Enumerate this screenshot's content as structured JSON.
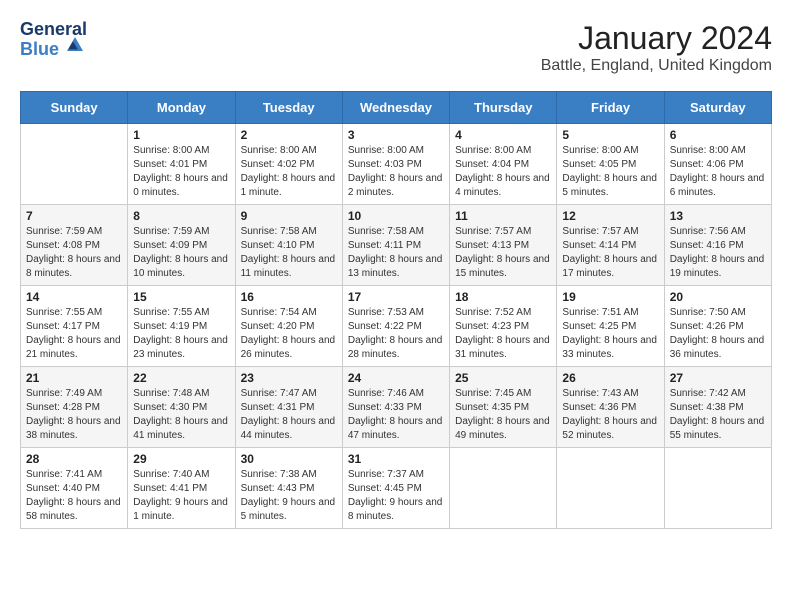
{
  "logo": {
    "general": "General",
    "blue": "Blue"
  },
  "title": "January 2024",
  "subtitle": "Battle, England, United Kingdom",
  "days_of_week": [
    "Sunday",
    "Monday",
    "Tuesday",
    "Wednesday",
    "Thursday",
    "Friday",
    "Saturday"
  ],
  "weeks": [
    [
      {
        "day": "",
        "sunrise": "",
        "sunset": "",
        "daylight": ""
      },
      {
        "day": "1",
        "sunrise": "Sunrise: 8:00 AM",
        "sunset": "Sunset: 4:01 PM",
        "daylight": "Daylight: 8 hours and 0 minutes."
      },
      {
        "day": "2",
        "sunrise": "Sunrise: 8:00 AM",
        "sunset": "Sunset: 4:02 PM",
        "daylight": "Daylight: 8 hours and 1 minute."
      },
      {
        "day": "3",
        "sunrise": "Sunrise: 8:00 AM",
        "sunset": "Sunset: 4:03 PM",
        "daylight": "Daylight: 8 hours and 2 minutes."
      },
      {
        "day": "4",
        "sunrise": "Sunrise: 8:00 AM",
        "sunset": "Sunset: 4:04 PM",
        "daylight": "Daylight: 8 hours and 4 minutes."
      },
      {
        "day": "5",
        "sunrise": "Sunrise: 8:00 AM",
        "sunset": "Sunset: 4:05 PM",
        "daylight": "Daylight: 8 hours and 5 minutes."
      },
      {
        "day": "6",
        "sunrise": "Sunrise: 8:00 AM",
        "sunset": "Sunset: 4:06 PM",
        "daylight": "Daylight: 8 hours and 6 minutes."
      }
    ],
    [
      {
        "day": "7",
        "sunrise": "Sunrise: 7:59 AM",
        "sunset": "Sunset: 4:08 PM",
        "daylight": "Daylight: 8 hours and 8 minutes."
      },
      {
        "day": "8",
        "sunrise": "Sunrise: 7:59 AM",
        "sunset": "Sunset: 4:09 PM",
        "daylight": "Daylight: 8 hours and 10 minutes."
      },
      {
        "day": "9",
        "sunrise": "Sunrise: 7:58 AM",
        "sunset": "Sunset: 4:10 PM",
        "daylight": "Daylight: 8 hours and 11 minutes."
      },
      {
        "day": "10",
        "sunrise": "Sunrise: 7:58 AM",
        "sunset": "Sunset: 4:11 PM",
        "daylight": "Daylight: 8 hours and 13 minutes."
      },
      {
        "day": "11",
        "sunrise": "Sunrise: 7:57 AM",
        "sunset": "Sunset: 4:13 PM",
        "daylight": "Daylight: 8 hours and 15 minutes."
      },
      {
        "day": "12",
        "sunrise": "Sunrise: 7:57 AM",
        "sunset": "Sunset: 4:14 PM",
        "daylight": "Daylight: 8 hours and 17 minutes."
      },
      {
        "day": "13",
        "sunrise": "Sunrise: 7:56 AM",
        "sunset": "Sunset: 4:16 PM",
        "daylight": "Daylight: 8 hours and 19 minutes."
      }
    ],
    [
      {
        "day": "14",
        "sunrise": "Sunrise: 7:55 AM",
        "sunset": "Sunset: 4:17 PM",
        "daylight": "Daylight: 8 hours and 21 minutes."
      },
      {
        "day": "15",
        "sunrise": "Sunrise: 7:55 AM",
        "sunset": "Sunset: 4:19 PM",
        "daylight": "Daylight: 8 hours and 23 minutes."
      },
      {
        "day": "16",
        "sunrise": "Sunrise: 7:54 AM",
        "sunset": "Sunset: 4:20 PM",
        "daylight": "Daylight: 8 hours and 26 minutes."
      },
      {
        "day": "17",
        "sunrise": "Sunrise: 7:53 AM",
        "sunset": "Sunset: 4:22 PM",
        "daylight": "Daylight: 8 hours and 28 minutes."
      },
      {
        "day": "18",
        "sunrise": "Sunrise: 7:52 AM",
        "sunset": "Sunset: 4:23 PM",
        "daylight": "Daylight: 8 hours and 31 minutes."
      },
      {
        "day": "19",
        "sunrise": "Sunrise: 7:51 AM",
        "sunset": "Sunset: 4:25 PM",
        "daylight": "Daylight: 8 hours and 33 minutes."
      },
      {
        "day": "20",
        "sunrise": "Sunrise: 7:50 AM",
        "sunset": "Sunset: 4:26 PM",
        "daylight": "Daylight: 8 hours and 36 minutes."
      }
    ],
    [
      {
        "day": "21",
        "sunrise": "Sunrise: 7:49 AM",
        "sunset": "Sunset: 4:28 PM",
        "daylight": "Daylight: 8 hours and 38 minutes."
      },
      {
        "day": "22",
        "sunrise": "Sunrise: 7:48 AM",
        "sunset": "Sunset: 4:30 PM",
        "daylight": "Daylight: 8 hours and 41 minutes."
      },
      {
        "day": "23",
        "sunrise": "Sunrise: 7:47 AM",
        "sunset": "Sunset: 4:31 PM",
        "daylight": "Daylight: 8 hours and 44 minutes."
      },
      {
        "day": "24",
        "sunrise": "Sunrise: 7:46 AM",
        "sunset": "Sunset: 4:33 PM",
        "daylight": "Daylight: 8 hours and 47 minutes."
      },
      {
        "day": "25",
        "sunrise": "Sunrise: 7:45 AM",
        "sunset": "Sunset: 4:35 PM",
        "daylight": "Daylight: 8 hours and 49 minutes."
      },
      {
        "day": "26",
        "sunrise": "Sunrise: 7:43 AM",
        "sunset": "Sunset: 4:36 PM",
        "daylight": "Daylight: 8 hours and 52 minutes."
      },
      {
        "day": "27",
        "sunrise": "Sunrise: 7:42 AM",
        "sunset": "Sunset: 4:38 PM",
        "daylight": "Daylight: 8 hours and 55 minutes."
      }
    ],
    [
      {
        "day": "28",
        "sunrise": "Sunrise: 7:41 AM",
        "sunset": "Sunset: 4:40 PM",
        "daylight": "Daylight: 8 hours and 58 minutes."
      },
      {
        "day": "29",
        "sunrise": "Sunrise: 7:40 AM",
        "sunset": "Sunset: 4:41 PM",
        "daylight": "Daylight: 9 hours and 1 minute."
      },
      {
        "day": "30",
        "sunrise": "Sunrise: 7:38 AM",
        "sunset": "Sunset: 4:43 PM",
        "daylight": "Daylight: 9 hours and 5 minutes."
      },
      {
        "day": "31",
        "sunrise": "Sunrise: 7:37 AM",
        "sunset": "Sunset: 4:45 PM",
        "daylight": "Daylight: 9 hours and 8 minutes."
      },
      {
        "day": "",
        "sunrise": "",
        "sunset": "",
        "daylight": ""
      },
      {
        "day": "",
        "sunrise": "",
        "sunset": "",
        "daylight": ""
      },
      {
        "day": "",
        "sunrise": "",
        "sunset": "",
        "daylight": ""
      }
    ]
  ]
}
